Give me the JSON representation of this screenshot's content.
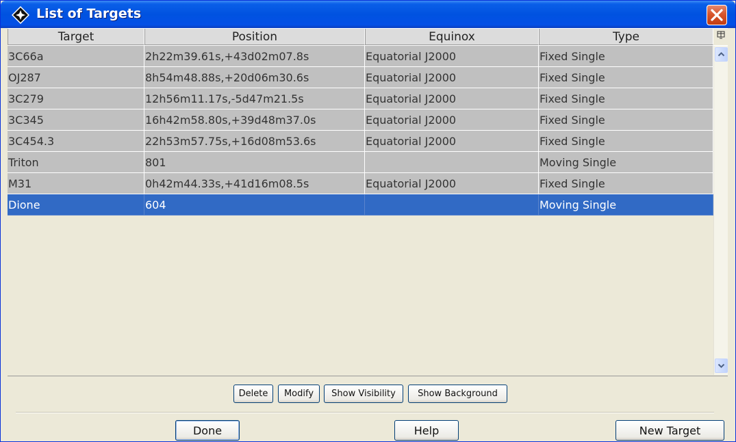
{
  "window": {
    "title": "List of Targets"
  },
  "icons": {
    "app": "star-diamond-icon",
    "close": "close-icon",
    "column_control": "column-control-icon",
    "scroll_up": "chevron-up-icon",
    "scroll_down": "chevron-down-icon"
  },
  "table": {
    "columns": [
      "Target",
      "Position",
      "Equinox",
      "Type"
    ],
    "rows": [
      {
        "target": "3C66a",
        "position": "2h22m39.61s,+43d02m07.8s",
        "equinox": "Equatorial J2000",
        "type": "Fixed Single",
        "selected": false
      },
      {
        "target": "OJ287",
        "position": "8h54m48.88s,+20d06m30.6s",
        "equinox": "Equatorial J2000",
        "type": "Fixed Single",
        "selected": false
      },
      {
        "target": "3C279",
        "position": "12h56m11.17s,-5d47m21.5s",
        "equinox": "Equatorial J2000",
        "type": "Fixed Single",
        "selected": false
      },
      {
        "target": "3C345",
        "position": "16h42m58.80s,+39d48m37.0s",
        "equinox": "Equatorial J2000",
        "type": "Fixed Single",
        "selected": false
      },
      {
        "target": "3C454.3",
        "position": "22h53m57.75s,+16d08m53.6s",
        "equinox": "Equatorial J2000",
        "type": "Fixed Single",
        "selected": false
      },
      {
        "target": "Triton",
        "position": "801",
        "equinox": "",
        "type": "Moving Single",
        "selected": false
      },
      {
        "target": "M31",
        "position": "0h42m44.33s,+41d16m08.5s",
        "equinox": "Equatorial J2000",
        "type": "Fixed Single",
        "selected": false
      },
      {
        "target": "Dione",
        "position": "604",
        "equinox": "",
        "type": "Moving Single",
        "selected": true
      }
    ]
  },
  "actions": {
    "delete": "Delete",
    "modify": "Modify",
    "show_visibility": "Show Visibility",
    "show_background": "Show Background"
  },
  "footer": {
    "done": "Done",
    "help": "Help",
    "new_target": "New Target"
  },
  "colors": {
    "title_bar": "#0052E0",
    "row_bg": "#C0C0C0",
    "selection": "#316AC5",
    "window_bg": "#ECE9D8"
  }
}
